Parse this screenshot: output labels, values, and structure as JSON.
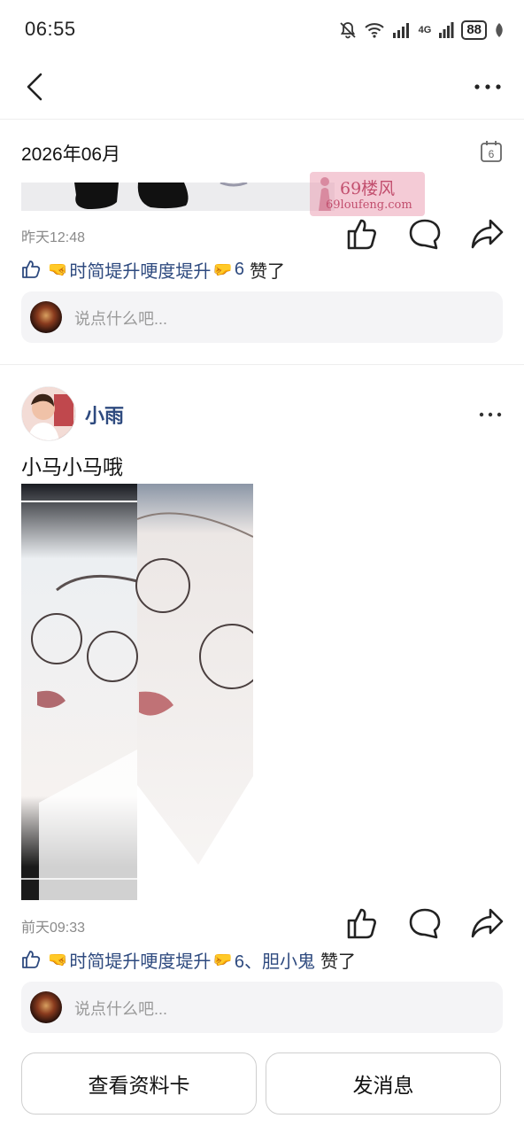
{
  "status_bar": {
    "time": "06:55",
    "signal_label": "4G",
    "battery": "88"
  },
  "nav": {
    "back_icon": "chevron-left-icon",
    "more_icon": "more-dots-icon"
  },
  "feed": {
    "month_header": "2026年06月",
    "calendar_day": "6",
    "watermark": {
      "line1": "69楼风",
      "line2": "69loufeng.com"
    },
    "posts": [
      {
        "time": "昨天12:48",
        "likes_text": "时简堤升哽度堤升",
        "likes_suffix": "6",
        "likes_tail": "赞了",
        "comment_placeholder": "说点什么吧..."
      },
      {
        "author": "小雨",
        "text": "小马小马哦",
        "time": "前天09:33",
        "likes_text": "时简堤升哽度堤升",
        "likes_suffix": "6、胆小鬼",
        "likes_tail": "赞了",
        "comment_placeholder": "说点什么吧..."
      }
    ]
  },
  "buttons": {
    "view_profile": "查看资料卡",
    "send_message": "发消息"
  },
  "colors": {
    "link_blue": "#2e4a7f",
    "gray_text": "#8a8a8a",
    "comment_bg": "#f4f4f6"
  }
}
